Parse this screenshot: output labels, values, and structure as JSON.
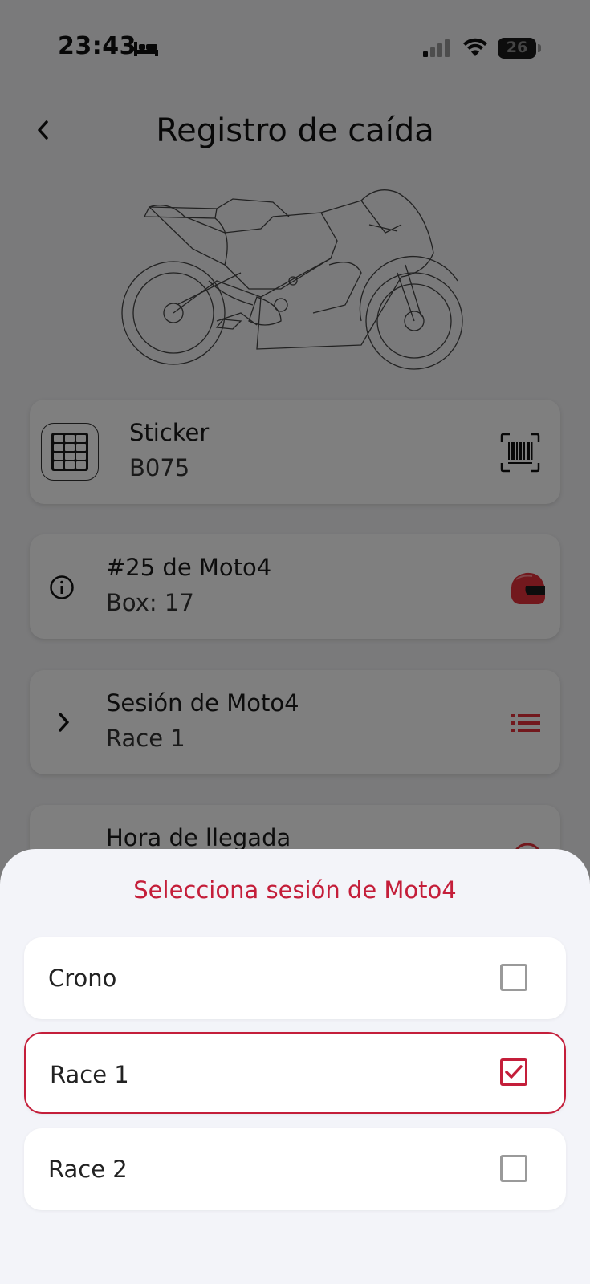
{
  "status_bar": {
    "time": "23:43",
    "battery_level": "26"
  },
  "header": {
    "title": "Registro de caída"
  },
  "cards": {
    "sticker": {
      "title": "Sticker",
      "value": "B075"
    },
    "rider": {
      "title": "#25 de Moto4",
      "value": "Box: 17"
    },
    "session": {
      "title": "Sesión de Moto4",
      "value": "Race 1"
    },
    "arrival": {
      "title": "Hora de llegada"
    }
  },
  "sheet": {
    "title": "Selecciona sesión de Moto4",
    "options": [
      {
        "label": "Crono",
        "checked": false
      },
      {
        "label": "Race 1",
        "checked": true
      },
      {
        "label": "Race 2",
        "checked": false
      }
    ]
  },
  "colors": {
    "accent": "#c41e3a",
    "overlay": "rgba(0,0,0,0.5)",
    "sheet_background": "#f3f4f9"
  },
  "icons": [
    "bed-icon",
    "signal-icon",
    "wifi-icon",
    "battery-icon",
    "back-chevron-icon",
    "motorcycle-illustration",
    "keypad-icon",
    "barcode-scan-icon",
    "info-icon",
    "helmet-icon",
    "chevron-right-icon",
    "list-icon",
    "clock-icon",
    "checkbox-icon"
  ]
}
